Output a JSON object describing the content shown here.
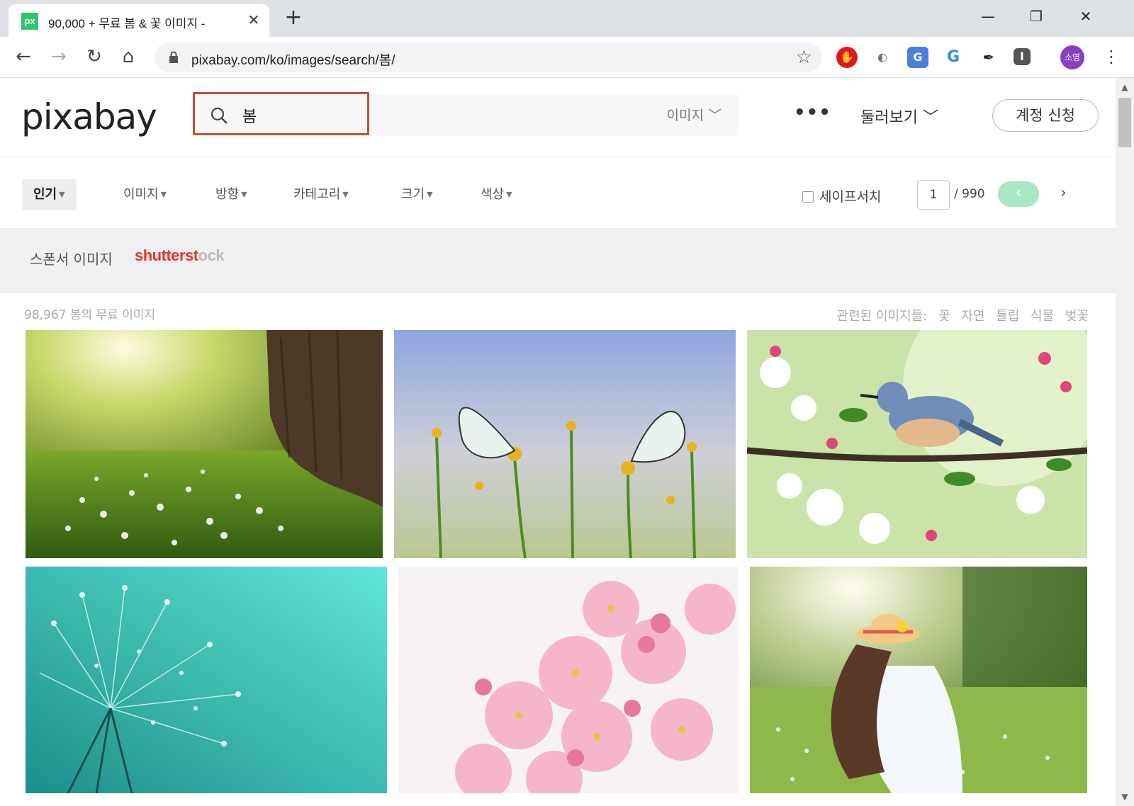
{
  "browser": {
    "tab_title": "90,000 + 무료 봄 & 꽃 이미지 -",
    "favicon_text": "px",
    "url": "pixabay.com/ko/images/search/봄/",
    "profile_initials": "소영"
  },
  "header": {
    "logo": "pixabay",
    "search_value": "봄",
    "search_type": "이미지",
    "explore": "둘러보기",
    "signup": "계정 신청"
  },
  "filters": {
    "items": [
      "인기",
      "이미지",
      "방향",
      "카테고리",
      "크기",
      "색상"
    ],
    "safesearch": "세이프서치",
    "page_current": "1",
    "page_total": "/ 990"
  },
  "sponsor": {
    "label": "스폰서 이미지",
    "brand_a": "shutterst",
    "brand_b": "ck"
  },
  "results": {
    "count": "98,967 봄의 무료 이미지",
    "related_label": "관련된 이미지들:",
    "related": [
      "꽃",
      "자연",
      "튤립",
      "식물",
      "벚꽃"
    ]
  },
  "colors": {
    "brand_green": "#2ec66d",
    "highlight": "#c0502e",
    "shutterstock": "#e6342c"
  }
}
